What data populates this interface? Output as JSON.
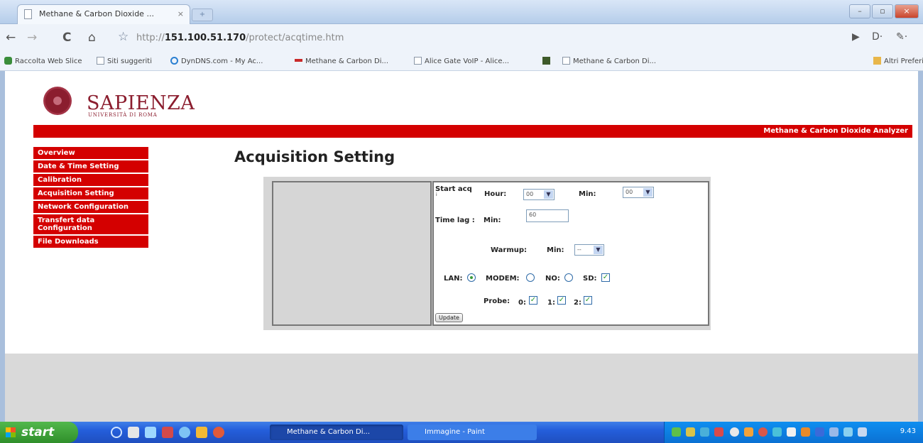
{
  "browser": {
    "tab_title": "Methane & Carbon Dioxide ...",
    "tab_close": "×",
    "new_tab": "+",
    "url_prefix": "http://",
    "url_host": "151.100.51.170",
    "url_path": "/protect/acqtime.htm",
    "nav_back": "←",
    "nav_forward": "→",
    "reload": "C",
    "home": "⌂",
    "star": "☆",
    "page_menu": "▶",
    "doc_menu": "D·",
    "wrench_menu": "✎·",
    "win_min": "–",
    "win_max": "▫",
    "win_close": "×",
    "bookmarks": [
      "Raccolta Web Slice",
      "Siti suggeriti",
      "DynDNS.com - My Ac...",
      "Methane & Carbon Di...",
      "Alice Gate VoIP - Alice...",
      "Methane & Carbon Di..."
    ],
    "other_bookmarks": "Altri Preferiti"
  },
  "site": {
    "logo_name": "SAPIENZA",
    "logo_sub": "UNIVERSITÀ DI ROMA",
    "banner": "Methane & Carbon Dioxide Analyzer",
    "menu": [
      "Overview",
      "Date & Time Setting",
      "Calibration",
      "Acquisition Setting",
      "Network Configuration",
      "Transfert data Configuration",
      "File Downloads"
    ],
    "heading": "Acquisition Setting"
  },
  "form": {
    "start_acq_label": "Start acq",
    "start_acq_sub": "i",
    "hour_label": "Hour:",
    "hour_value": "00",
    "min_label": "Min:",
    "min_value": "00",
    "time_lag_label": "Time lag :",
    "time_lag_min_label": "Min:",
    "time_lag_value": "60",
    "warmup_label": "Warmup:",
    "warmup_min_label": "Min:",
    "warmup_value": "--",
    "lan_label": "LAN:",
    "modem_label": "MODEM:",
    "no_label": "NO:",
    "sd_label": "SD:",
    "probe_label": "Probe:",
    "probe0_label": "0:",
    "probe1_label": "1:",
    "probe2_label": "2:",
    "update_button": "Update",
    "select_arrow": "▼",
    "check_mark": "✓"
  },
  "states": {
    "lan": true,
    "modem": false,
    "no": false,
    "sd": true,
    "probe0": true,
    "probe1": true,
    "probe2": true
  },
  "taskbar": {
    "start_label": "start",
    "tasks": [
      "Methane & Carbon Di...",
      "Immagine - Paint"
    ],
    "clock": "9.43"
  }
}
